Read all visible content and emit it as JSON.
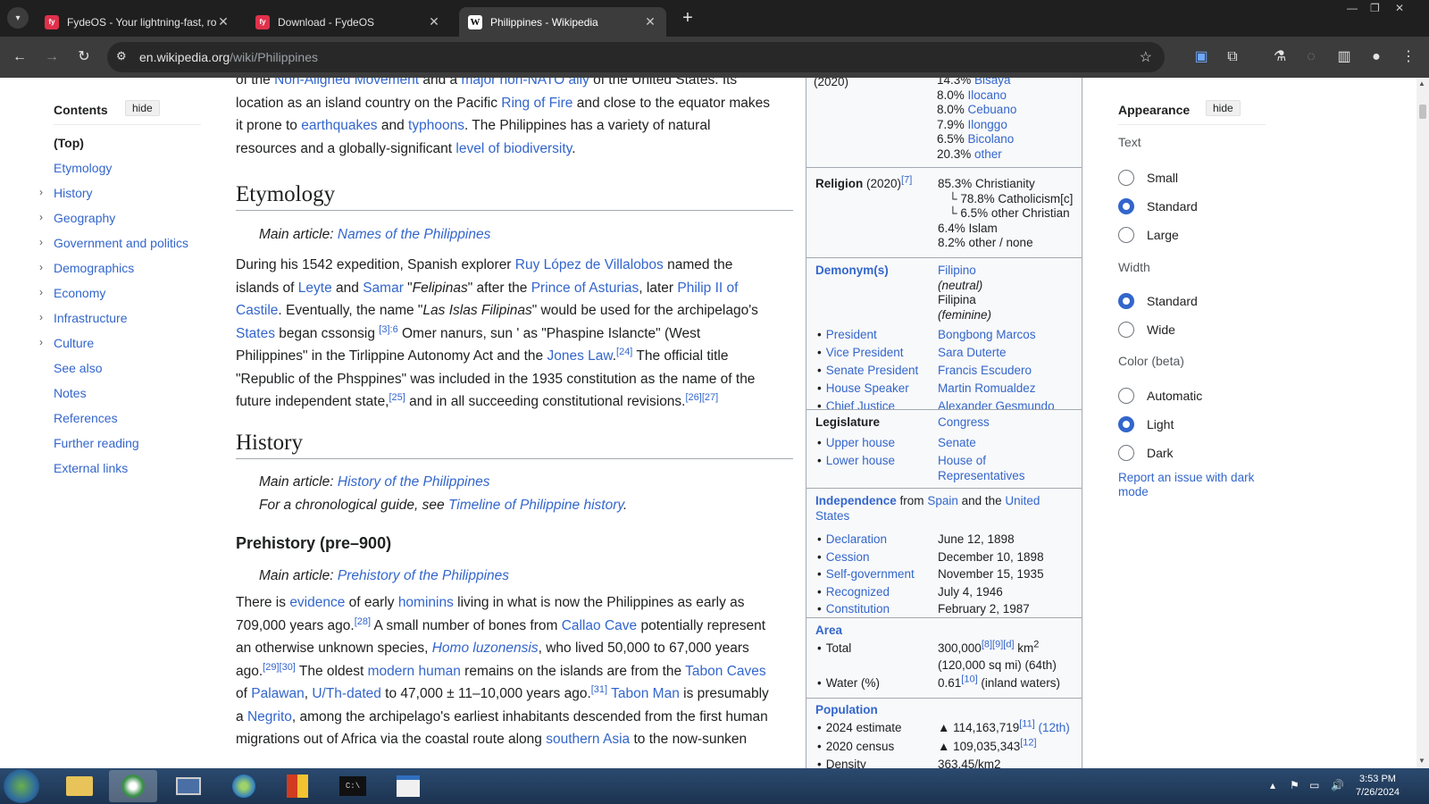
{
  "browser": {
    "tabs": [
      {
        "title": "FydeOS - Your lightning-fast, ro",
        "icon": "fydeos-favicon",
        "active": false
      },
      {
        "title": "Download - FydeOS",
        "icon": "fydeos-favicon",
        "active": false
      },
      {
        "title": "Philippines - Wikipedia",
        "icon": "wikipedia-favicon",
        "active": true
      }
    ],
    "new_tab": "+",
    "url_domain": "en.wikipedia.org",
    "url_path": "/wiki/Philippines"
  },
  "toc": {
    "title": "Contents",
    "hide": "hide",
    "items": [
      {
        "label": "(Top)",
        "expandable": false
      },
      {
        "label": "Etymology",
        "expandable": false
      },
      {
        "label": "History",
        "expandable": true
      },
      {
        "label": "Geography",
        "expandable": true
      },
      {
        "label": "Government and politics",
        "expandable": true
      },
      {
        "label": "Demographics",
        "expandable": true
      },
      {
        "label": "Economy",
        "expandable": true
      },
      {
        "label": "Infrastructure",
        "expandable": true
      },
      {
        "label": "Culture",
        "expandable": true
      },
      {
        "label": "See also",
        "expandable": false
      },
      {
        "label": "Notes",
        "expandable": false
      },
      {
        "label": "References",
        "expandable": false
      },
      {
        "label": "Further reading",
        "expandable": false
      },
      {
        "label": "External links",
        "expandable": false
      }
    ]
  },
  "article": {
    "intro_lines": [
      "of the Non-Aligned Movement and a major non-NATO ally of the United States. Its",
      "location as an island country on the Pacific Ring of Fire and close to the equator makes",
      "it prone to earthquakes and typhoons. The Philippines has a variety of natural",
      "resources and a globally-significant level of biodiversity."
    ],
    "etymology": {
      "heading": "Etymology",
      "hatnote_prefix": "Main article: ",
      "hatnote_link": "Names of the Philippines",
      "lines": [
        "During his 1542 expedition, Spanish explorer Ruy López de Villalobos named the",
        "islands of Leyte and Samar \"Felipinas\" after the Prince of Asturias, later Philip II of",
        "Castile. Eventually, the name \"Las Islas Filipinas\" would be used for the archipelago's",
        "States began cssonsig [3]:6 Omer nanurs, sun ' as \"Phaspine Islancte\" (West",
        "Philippines\" in the Tirlippine Autonomy Act and the Jones Law.[24] The official title",
        "\"Republic of the Phsppines\" was included in the 1935 constitution as the name of the",
        "future independent state,[25] and in all succeeding constitutional revisions.[26][27]"
      ]
    },
    "history": {
      "heading": "History",
      "hatnote1_prefix": "Main article: ",
      "hatnote1_link": "History of the Philippines",
      "hatnote2_prefix": "For a chronological guide, see ",
      "hatnote2_link": "Timeline of Philippine history",
      "hatnote2_suffix": "."
    },
    "prehistory": {
      "heading": "Prehistory (pre–900)",
      "hatnote_prefix": "Main article: ",
      "hatnote_link": "Prehistory of the Philippines",
      "lines": [
        "There is evidence of early hominins living in what is now the Philippines as early as",
        "709,000 years ago.[28] A small number of bones from Callao Cave potentially represent",
        "an otherwise unknown species, Homo luzonensis, who lived 50,000 to 67,000 years",
        "ago.[29][30] The oldest modern human remains on the islands are from the Tabon Caves",
        "of Palawan, U/Th-dated to 47,000 ± 11–10,000 years ago.[31] Tabon Man is presumably",
        "a Negrito, among the archipelago's earliest inhabitants descended from the first human",
        "migrations out of Africa via the coastal route along southern Asia to the now-sunken"
      ]
    }
  },
  "infobox": {
    "ethnic_year": "(2020)",
    "ethnic_groups": [
      "14.3% Bisaya",
      "8.0% Ilocano",
      "8.0% Cebuano",
      "7.9% Ilonggo",
      "6.5% Bicolano",
      "20.3% other"
    ],
    "religion_label": "Religion",
    "religion_year": "(2020)",
    "religion_ref": "[7]",
    "religion": [
      "85.3% Christianity",
      "78.8% Catholicism[c]",
      "6.5% other Christian",
      "6.4% Islam",
      "8.2% other / none"
    ],
    "demonym_label": "Demonym(s)",
    "demonyms": [
      "Filipino",
      "(neutral)",
      "Filipina",
      "(feminine)"
    ],
    "leaders": [
      {
        "role": "President",
        "name": "Bongbong Marcos"
      },
      {
        "role": "Vice President",
        "name": "Sara Duterte"
      },
      {
        "role": "Senate President",
        "name": "Francis Escudero"
      },
      {
        "role": "House Speaker",
        "name": "Martin Romualdez"
      },
      {
        "role": "Chief Justice",
        "name": "Alexander Gesmundo"
      }
    ],
    "legislature_label": "Legislature",
    "legislature_value": "Congress",
    "houses": [
      {
        "role": "Upper house",
        "name": "Senate"
      },
      {
        "role": "Lower house",
        "name": "House of Representatives"
      }
    ],
    "independence_label": "Independence",
    "independence_from": "from",
    "independence_spain": "Spain",
    "independence_and": "and the",
    "independence_us": "United States",
    "independence_events": [
      {
        "event": "Declaration",
        "date": "June 12, 1898"
      },
      {
        "event": "Cession",
        "date": "December 10, 1898"
      },
      {
        "event": "Self-government",
        "date": "November 15, 1935"
      },
      {
        "event": "Recognized",
        "date": "July 4, 1946"
      },
      {
        "event": "Constitution",
        "date": "February 2, 1987"
      }
    ],
    "area_label": "Area",
    "area_total_label": "Total",
    "area_total": "300,000",
    "area_total_refs": "[8][9][d]",
    "area_total_unit": "km",
    "area_total_sqmi": "(120,000 sq mi) (64th)",
    "water_label": "Water (%)",
    "water_value": "0.61",
    "water_ref": "[10]",
    "water_note": "(inland waters)",
    "population_label": "Population",
    "pop_2024_label": "2024 estimate",
    "pop_2024": "114,163,719",
    "pop_2024_ref": "[11]",
    "pop_2024_rank": "(12th)",
    "pop_2020_label": "2020 census",
    "pop_2020": "109,035,343",
    "pop_2020_ref": "[12]",
    "density_label": "Density",
    "density_value": "363.45/km2"
  },
  "appearance": {
    "title": "Appearance",
    "hide": "hide",
    "text_caption": "Text",
    "text_options": [
      {
        "label": "Small",
        "selected": false
      },
      {
        "label": "Standard",
        "selected": true
      },
      {
        "label": "Large",
        "selected": false
      }
    ],
    "width_caption": "Width",
    "width_options": [
      {
        "label": "Standard",
        "selected": true
      },
      {
        "label": "Wide",
        "selected": false
      }
    ],
    "color_caption": "Color (beta)",
    "color_options": [
      {
        "label": "Automatic",
        "selected": false
      },
      {
        "label": "Light",
        "selected": true
      },
      {
        "label": "Dark",
        "selected": false
      }
    ],
    "report_link": "Report an issue with dark mode"
  },
  "taskbar": {
    "time": "3:53 PM",
    "date": "7/26/2024"
  },
  "colors": {
    "link": "#3366cc",
    "tab_bar": "#1f1f1f",
    "toolbar": "#3c3c3c",
    "radio_selected": "#3366cc"
  }
}
